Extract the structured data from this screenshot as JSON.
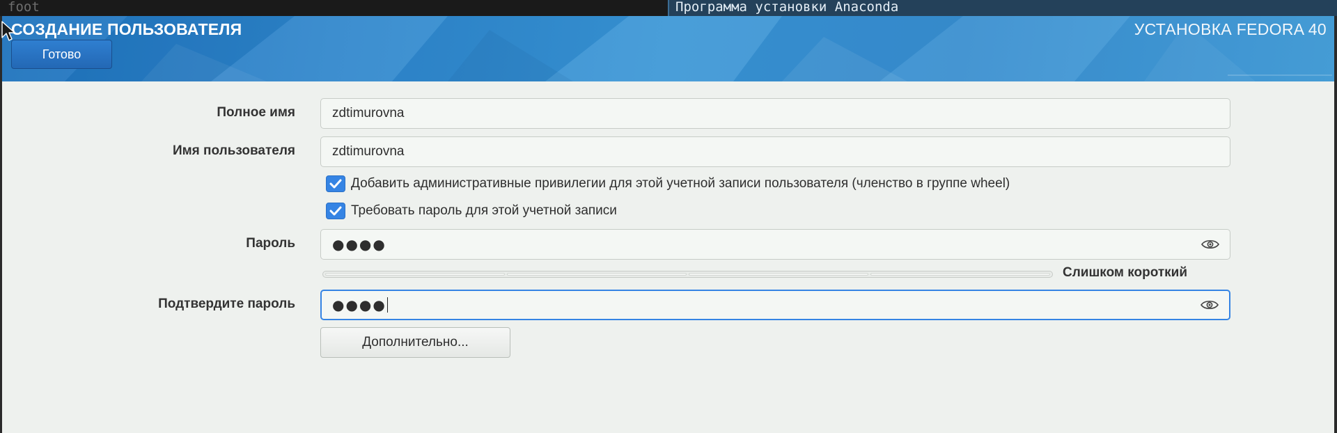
{
  "taskbar": {
    "inactive_window": "foot",
    "active_window": "Программа установки Anaconda"
  },
  "header": {
    "title": "СОЗДАНИЕ ПОЛЬЗОВАТЕЛЯ",
    "product": "УСТАНОВКА FEDORA 40",
    "done_label": "Готово"
  },
  "form": {
    "fullname_label": "Полное имя",
    "fullname_value": "zdtimurovna",
    "username_label": "Имя пользователя",
    "username_value": "zdtimurovna",
    "admin_checkbox_label": "Добавить административные привилегии для этой учетной записи пользователя (членство в группе wheel)",
    "admin_checked": true,
    "require_password_label": "Требовать пароль для этой учетной записи",
    "require_password_checked": true,
    "password_label": "Пароль",
    "password_mask": "●●●●",
    "strength_text": "Слишком короткий",
    "strength_level": 0,
    "confirm_label": "Подтвердите пароль",
    "confirm_mask": "●●●●",
    "advanced_label": "Дополнительно..."
  },
  "colors": {
    "accent": "#3584e4",
    "header_blue": "#2f86cc"
  },
  "icons": {
    "password_reveal": "eye-icon",
    "checkbox": "checkmark-icon",
    "pointer": "mouse-cursor-icon"
  }
}
